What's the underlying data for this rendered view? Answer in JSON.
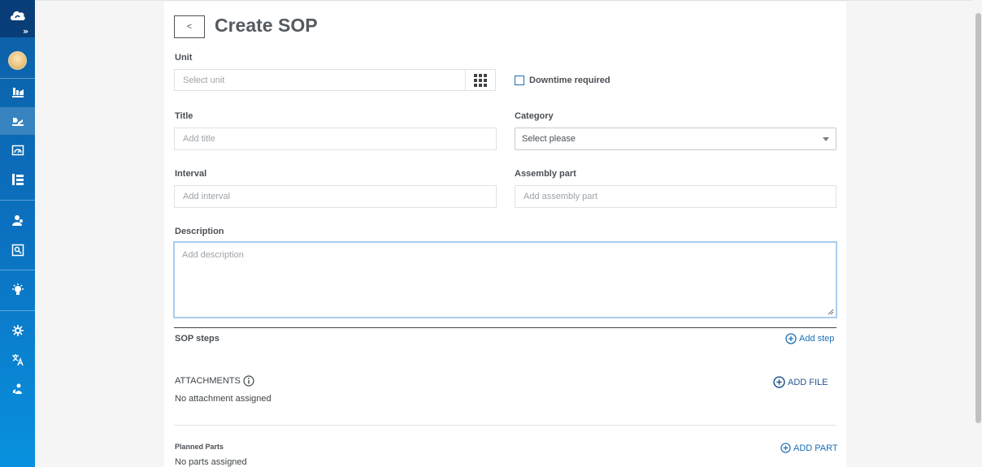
{
  "sidebar": {
    "expand_glyph": "»",
    "items": [
      {
        "name": "sidebar-item-plant",
        "icon": "plant-icon",
        "active": false
      },
      {
        "name": "sidebar-item-maintenance",
        "icon": "maintenance-icon",
        "active": true
      },
      {
        "name": "sidebar-item-dashboard",
        "icon": "gauge-icon",
        "active": false
      },
      {
        "name": "sidebar-item-structure",
        "icon": "tree-icon",
        "active": false
      },
      {
        "name": "sidebar-item-users",
        "icon": "people-icon",
        "active": false
      },
      {
        "name": "sidebar-item-reports",
        "icon": "report-icon",
        "active": false
      },
      {
        "name": "sidebar-item-insights",
        "icon": "lightbulb-icon",
        "active": false
      },
      {
        "name": "sidebar-item-settings",
        "icon": "gear-icon",
        "active": false
      },
      {
        "name": "sidebar-item-language",
        "icon": "translate-icon",
        "active": false
      },
      {
        "name": "sidebar-item-support",
        "icon": "support-icon",
        "active": false
      }
    ]
  },
  "header": {
    "back_label": "<",
    "title": "Create SOP"
  },
  "form": {
    "unit": {
      "label": "Unit",
      "placeholder": "Select unit"
    },
    "downtime": {
      "label": "Downtime required",
      "checked": false
    },
    "title": {
      "label": "Title",
      "placeholder": "Add title"
    },
    "category": {
      "label": "Category",
      "value": "Select please"
    },
    "interval": {
      "label": "Interval",
      "placeholder": "Add interval"
    },
    "assembly_part": {
      "label": "Assembly part",
      "placeholder": "Add assembly part"
    },
    "description": {
      "label": "Description",
      "placeholder": "Add description"
    }
  },
  "sop_steps": {
    "title": "SOP steps",
    "add_label": "Add step"
  },
  "attachments": {
    "title": "ATTACHMENTS",
    "add_label": "ADD FILE",
    "empty_text": "No attachment assigned"
  },
  "planned_parts": {
    "title": "Planned Parts",
    "add_label": "ADD PART",
    "empty_text": "No parts assigned"
  },
  "colors": {
    "accent": "#1b6fb5",
    "sidebar_top": "#0a3e78",
    "sidebar_bottom": "#0891de"
  }
}
